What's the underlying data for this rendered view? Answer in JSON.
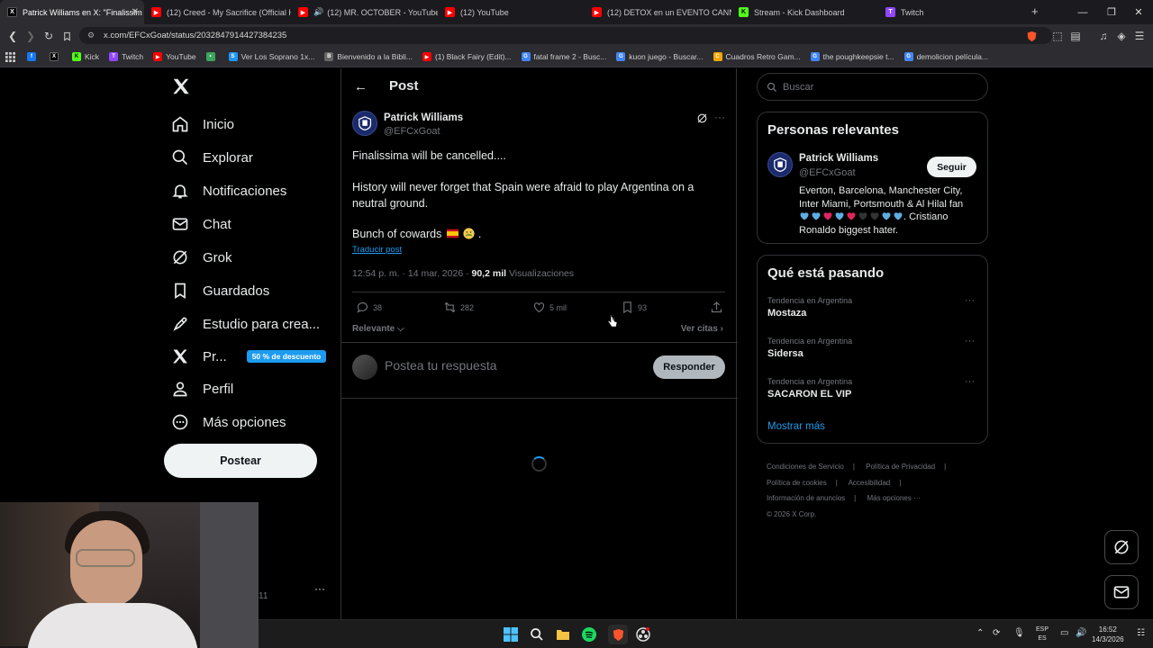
{
  "browser": {
    "tabs": [
      {
        "title": "Patrick Williams en X: \"Finalissim",
        "active": true,
        "fav": "X",
        "fav_color": "#000000"
      },
      {
        "title": "(12) Creed - My Sacrifice (Official HD",
        "fav": "▶",
        "fav_color": "#ff0000"
      },
      {
        "title": "(12) MR. OCTOBER - YouTube",
        "fav": "▶",
        "fav_color": "#ff0000"
      },
      {
        "title": "(12) YouTube",
        "fav": "▶",
        "fav_color": "#ff0000"
      },
      {
        "title": "(12) DETOX en un EVENTO CANNABI",
        "fav": "▶",
        "fav_color": "#ff0000"
      },
      {
        "title": "Stream - Kick Dashboard",
        "fav": "K",
        "fav_color": "#53fc18"
      },
      {
        "title": "Twitch",
        "fav": "T",
        "fav_color": "#9146ff"
      }
    ],
    "url": "x.com/EFCxGoat/status/2032847914427384235",
    "bookmarks": [
      {
        "label": "",
        "fav": "f",
        "color": "#1877f2"
      },
      {
        "label": "",
        "fav": "X",
        "color": "#000000"
      },
      {
        "label": "Kick",
        "fav": "K",
        "color": "#53fc18"
      },
      {
        "label": "Twitch",
        "fav": "T",
        "color": "#9146ff"
      },
      {
        "label": "YouTube",
        "fav": "▶",
        "color": "#ff0000"
      },
      {
        "label": "",
        "fav": "•",
        "color": "#3ba55c"
      },
      {
        "label": "Ver Los Soprano 1x...",
        "fav": "S",
        "color": "#2196f3"
      },
      {
        "label": "Bienvenido a la Bibli...",
        "fav": "B",
        "color": "#666666"
      },
      {
        "label": "(1) Black Fairy (Edit)...",
        "fav": "▶",
        "color": "#ff0000"
      },
      {
        "label": "fatal frame 2 - Busc...",
        "fav": "G",
        "color": "#4285f4"
      },
      {
        "label": "kuon juego - Buscar...",
        "fav": "G",
        "color": "#4285f4"
      },
      {
        "label": "Cuadros Retro Gam...",
        "fav": "C",
        "color": "#f2a600"
      },
      {
        "label": "the poughkeepsie t...",
        "fav": "G",
        "color": "#4285f4"
      },
      {
        "label": "demolicion película...",
        "fav": "G",
        "color": "#4285f4"
      }
    ]
  },
  "nav": {
    "items": [
      {
        "label": "Inicio",
        "icon": "home-icon"
      },
      {
        "label": "Explorar",
        "icon": "search-icon"
      },
      {
        "label": "Notificaciones",
        "icon": "bell-icon"
      },
      {
        "label": "Chat",
        "icon": "mail-icon"
      },
      {
        "label": "Grok",
        "icon": "grok-icon"
      },
      {
        "label": "Guardados",
        "icon": "bookmark-icon"
      },
      {
        "label": "Estudio para crea...",
        "icon": "rocket-icon"
      },
      {
        "label": "Pr...",
        "icon": "x-icon"
      },
      {
        "label": "Perfil",
        "icon": "person-icon"
      },
      {
        "label": "Más opciones",
        "icon": "more-circle-icon"
      }
    ],
    "premium_badge": "50 % de descuento",
    "post_button": "Postear"
  },
  "main": {
    "header_title": "Post",
    "tweet": {
      "name": "Patrick Williams",
      "handle": "@EFCxGoat",
      "line1": "Finalissima will be cancelled....",
      "line2": "History will never forget that Spain were afraid to play Argentina on a",
      "line3": "neutral ground.",
      "line4": "Bunch of cowards",
      "translate": "Traducir post",
      "time": "12:54 p. m. · 14 mar. 2026 · ",
      "views_count": "90,2 mil",
      "views_label": " Visualizaciones",
      "replies": "38",
      "reposts": "282",
      "likes": "5 mil",
      "bookmarks": "93"
    },
    "sort_label": "Relevante",
    "quotes_label": "Ver citas",
    "reply_placeholder": "Postea tu respuesta",
    "reply_button": "Responder"
  },
  "sidebar": {
    "search_placeholder": "Buscar",
    "relevant_title": "Personas relevantes",
    "relevant_person": {
      "name": "Patrick Williams",
      "handle": "@EFCxGoat",
      "follow": "Seguir",
      "bio_1": "Everton, Barcelona, Manchester City, Inter Miami, Portsmouth & Al Hilal fan",
      "bio_2": ". Cristiano Ronaldo biggest hater.",
      "heart_colors": [
        "#5dade2",
        "#5dade2",
        "#e0245e",
        "#5dade2",
        "#e0245e",
        "#333333",
        "#333333",
        "#5dade2",
        "#5dade2"
      ]
    },
    "trends_title": "Qué está pasando",
    "trends": [
      {
        "context": "Tendencia en Argentina",
        "topic": "Mostaza"
      },
      {
        "context": "Tendencia en Argentina",
        "topic": "Sidersa"
      },
      {
        "context": "Tendencia en Argentina",
        "topic": "SACARON EL VIP"
      }
    ],
    "show_more": "Mostrar más",
    "footer": [
      "Condiciones de Servicio",
      "Política de Privacidad",
      "Política de cookies",
      "Accesibilidad",
      "Información de anuncios",
      "Más opciones ···",
      "© 2026 X Corp."
    ]
  },
  "overlay": {
    "cam_number": "11"
  },
  "taskbar": {
    "lang_1": "ESP",
    "lang_2": "ES",
    "time": "16:52",
    "date": "14/3/2026"
  }
}
